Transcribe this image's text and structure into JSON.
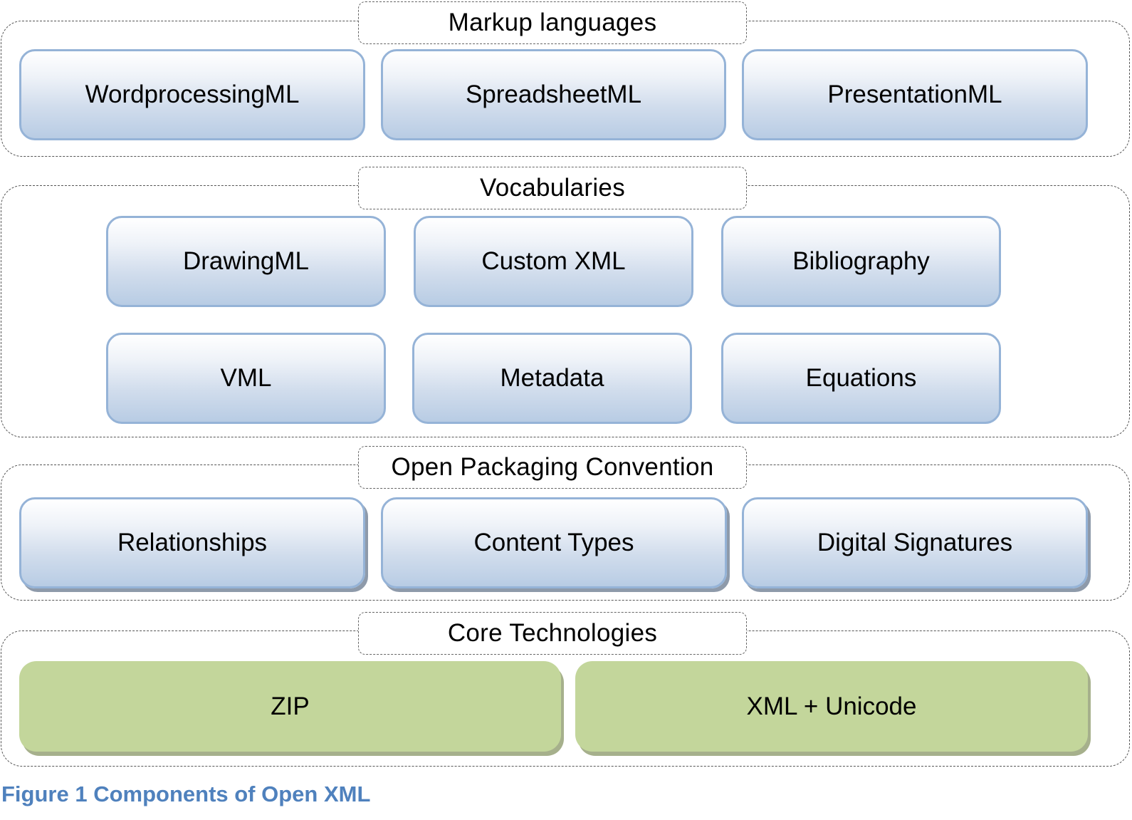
{
  "diagram": {
    "layers": [
      {
        "title": "Markup languages",
        "items": [
          "WordprocessingML",
          "SpreadsheetML",
          "PresentationML"
        ]
      },
      {
        "title": "Vocabularies",
        "items": [
          "DrawingML",
          "Custom XML",
          "Bibliography",
          "VML",
          "Metadata",
          "Equations"
        ]
      },
      {
        "title": "Open Packaging Convention",
        "items": [
          "Relationships",
          "Content Types",
          "Digital Signatures"
        ]
      },
      {
        "title": "Core Technologies",
        "items": [
          "ZIP",
          "XML + Unicode"
        ]
      }
    ],
    "colors": {
      "box_border": "#95b3d7",
      "box_fill_bottom": "#b8cce4",
      "core_fill": "#c3d69b",
      "caption": "#4f81bd"
    }
  },
  "caption": "Figure 1 Components of Open XML"
}
